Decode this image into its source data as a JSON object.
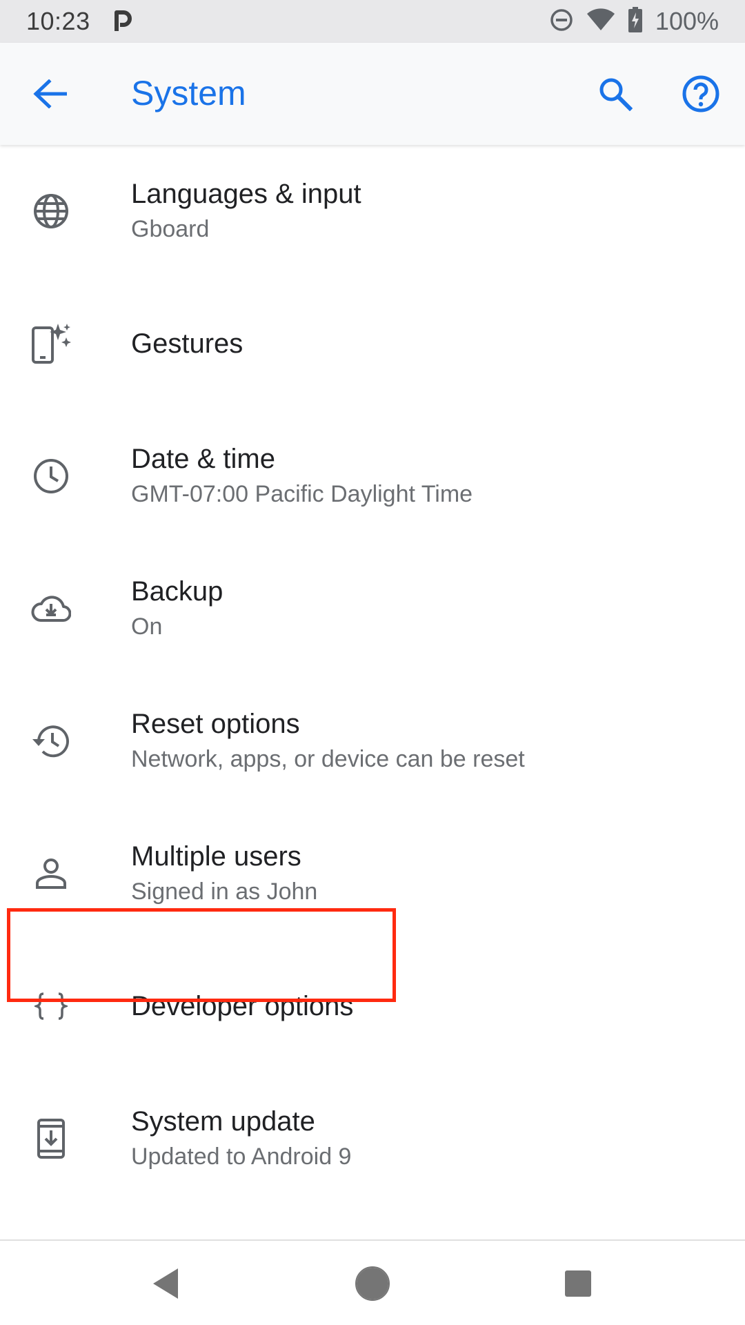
{
  "status_bar": {
    "time": "10:23",
    "battery": "100%",
    "icons": [
      "parking-icon",
      "dnd-icon",
      "wifi-icon",
      "battery-charging-icon"
    ]
  },
  "app_bar": {
    "title": "System",
    "accent_color": "#1a73e8",
    "icons": [
      "back-arrow-icon",
      "search-icon",
      "help-icon"
    ]
  },
  "items": [
    {
      "title": "Languages & input",
      "subtitle": "Gboard",
      "icon": "globe-icon"
    },
    {
      "title": "Gestures",
      "subtitle": "",
      "icon": "gestures-phone-sparkle-icon"
    },
    {
      "title": "Date & time",
      "subtitle": "GMT-07:00 Pacific Daylight Time",
      "icon": "clock-icon"
    },
    {
      "title": "Backup",
      "subtitle": "On",
      "icon": "cloud-upload-icon"
    },
    {
      "title": "Reset options",
      "subtitle": "Network, apps, or device can be reset",
      "icon": "history-icon"
    },
    {
      "title": "Multiple users",
      "subtitle": "Signed in as John",
      "icon": "person-icon"
    },
    {
      "title": "Developer options",
      "subtitle": "",
      "icon": "braces-icon"
    },
    {
      "title": "System update",
      "subtitle": "Updated to Android 9",
      "icon": "system-update-icon"
    }
  ],
  "highlight_color": "#ff2a10",
  "nav_bar": {
    "icons": [
      "nav-back-icon",
      "nav-home-icon",
      "nav-recents-icon"
    ]
  }
}
